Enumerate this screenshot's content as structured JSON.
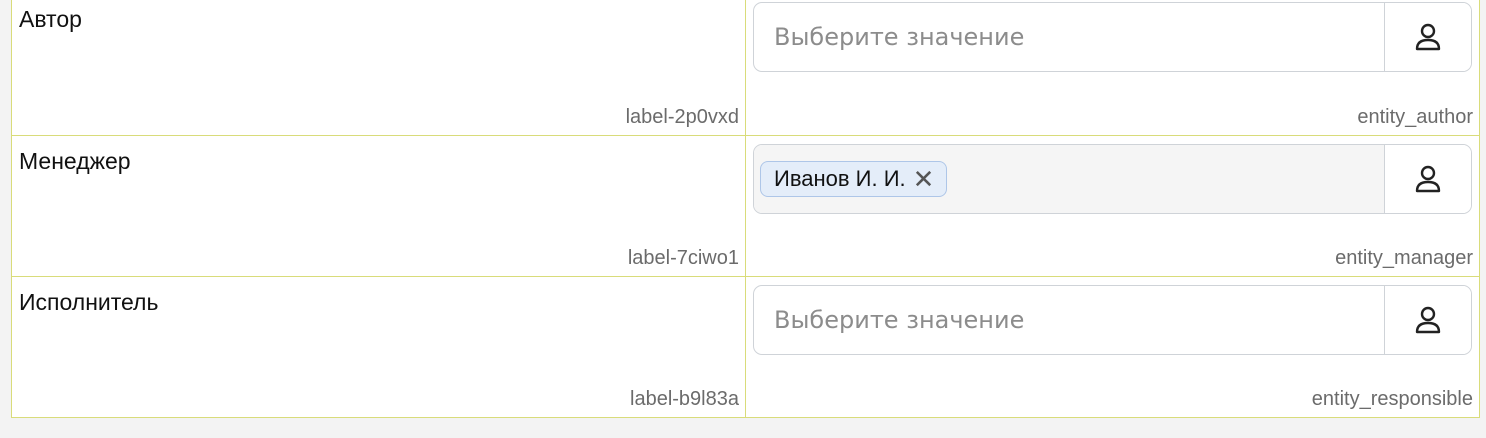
{
  "rows": [
    {
      "label": "Автор",
      "label_id": "label-2p0vxd",
      "field_id": "entity_author",
      "placeholder": "Выберите значение",
      "button_icon": "user-icon"
    },
    {
      "label": "Менеджер",
      "label_id": "label-7ciwo1",
      "field_id": "entity_manager",
      "selected_value": "Иванов И. И.",
      "remove_glyph": "✕",
      "button_icon": "user-icon"
    },
    {
      "label": "Исполнитель",
      "label_id": "label-b9l83a",
      "field_id": "entity_responsible",
      "placeholder": "Выберите значение",
      "button_icon": "user-icon"
    }
  ],
  "colors": {
    "grid_border": "#d9dc7a",
    "chip_background": "#e4edf9",
    "chip_border": "#aec6e8",
    "placeholder": "#8c8c8c"
  }
}
